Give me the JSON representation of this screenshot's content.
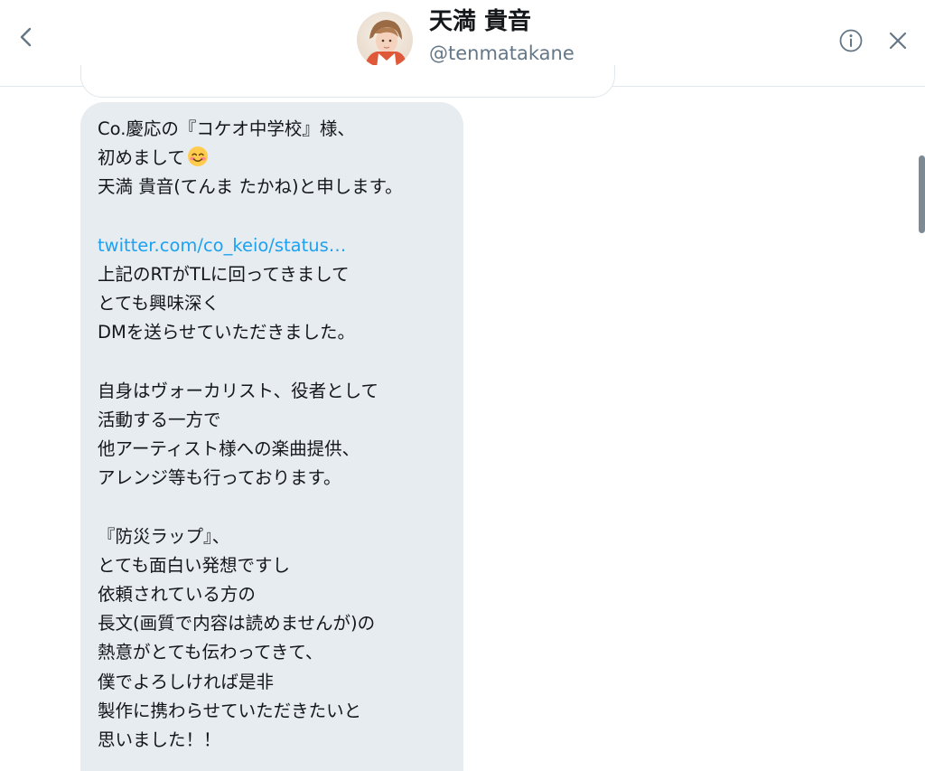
{
  "header": {
    "display_name": "天満 貴音",
    "handle": "@tenmatakane"
  },
  "icons": {
    "back": "chevron-left-icon",
    "info": "info-icon",
    "close": "close-icon",
    "emoji": "smiling-face-emoji"
  },
  "colors": {
    "accent": "#1da1f2",
    "bubble": "#e6ecf0",
    "text": "#14171a",
    "secondary": "#657786"
  },
  "message": {
    "lines": [
      "Co.慶応の『コケオ中学校』様、",
      "初めまして",
      "天満 貴音(てんま たかね)と申します。",
      "",
      "twitter.com/co_keio/status…",
      "上記のRTがTLに回ってきまして",
      "とても興味深く",
      "DMを送らせていただきました。",
      "",
      "自身はヴォーカリスト、役者として",
      "活動する一方で",
      "他アーティスト様への楽曲提供、",
      "アレンジ等も行っております。",
      "",
      "『防災ラップ』、",
      "とても面白い発想ですし",
      "依頼されている方の",
      "長文(画質で内容は読めませんが)の",
      "熱意がとても伝わってきて、",
      "僕でよろしければ是非",
      "製作に携わらせていただきたいと",
      "思いました！！"
    ]
  }
}
